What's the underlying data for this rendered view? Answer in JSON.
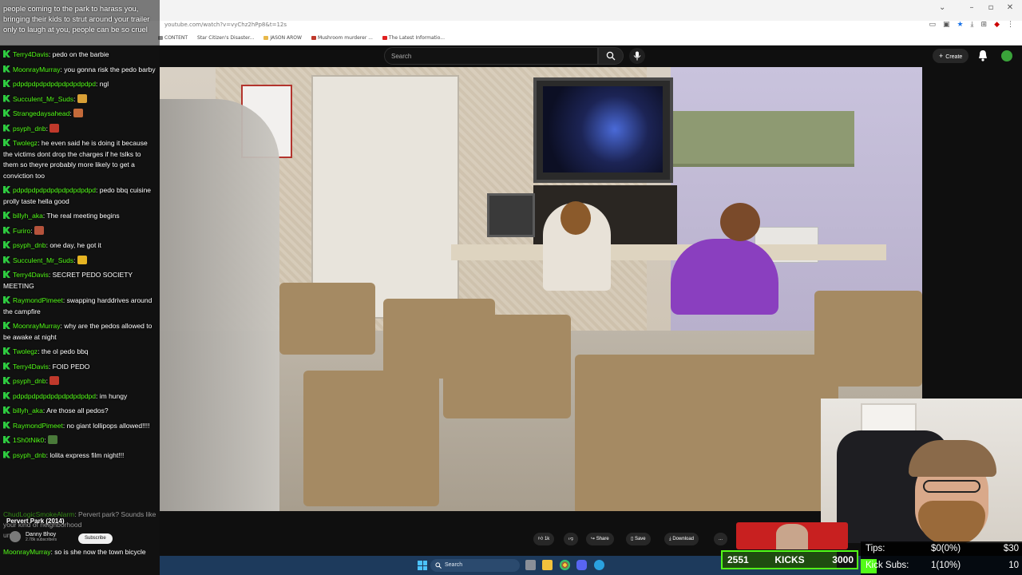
{
  "browser": {
    "url": "youtube.com/watch?v=vyChz2hPp8&t=12s",
    "bookmarks": [
      "CONTENT",
      "Star Citizen's Disaster...",
      "JASON AROW",
      "Mushroom murderer ...",
      "The Latest Informatio..."
    ]
  },
  "youtube": {
    "search_placeholder": "Search",
    "create_label": "Create",
    "likes": "1k",
    "share_label": "Share",
    "save_label": "Save",
    "download_label": "Download",
    "more_label": "...",
    "channel_name": "Danny Bhoy",
    "channel_subs": "2.78k subscribers",
    "subscribe_label": "Subscribe"
  },
  "chat": {
    "top_text": "people coming to the park to harass you, bringing their kids to strut around your trailer only to laugh at you, people can be so cruel",
    "messages": [
      {
        "user": "Terry4Davis",
        "text": "pedo on the barbie"
      },
      {
        "user": "MoonrayMurray",
        "text": "you gonna risk the pedo barby"
      },
      {
        "user": "pdpdpdpdpdpdpdpdpdpdpd",
        "text": "ngl"
      },
      {
        "user": "Succulent_Mr_Suds",
        "text": "",
        "emote": "#d9a036"
      },
      {
        "user": "Strangedaysahead",
        "text": "",
        "emote": "#c46a3a"
      },
      {
        "user": "psyph_dnb",
        "text": "",
        "emote": "#c0392b"
      },
      {
        "user": "Twolegz",
        "text": "he even said he is doing it because the victims dont drop the charges if he tslks to them so theyre probably more likely to get a conviction too"
      },
      {
        "user": "pdpdpdpdpdpdpdpdpdpdpd",
        "text": "pedo bbq cuisine prolly taste hella good"
      },
      {
        "user": "billyh_aka",
        "text": "The real meeting begins"
      },
      {
        "user": "Furiro",
        "text": "",
        "emote": "#b5533c"
      },
      {
        "user": "psyph_dnb",
        "text": "one day, he got it"
      },
      {
        "user": "Succulent_Mr_Suds",
        "text": "",
        "emote": "#e6b422"
      },
      {
        "user": "Terry4Davis",
        "text": "SECRET PEDO SOCIETY MEETING"
      },
      {
        "user": "RaymondPimeet",
        "text": "swapping harddrives around the campfire"
      },
      {
        "user": "MoonrayMurray",
        "text": "why are the pedos allowed to be awake at night"
      },
      {
        "user": "Twolegz",
        "text": "the ol pedo bbq"
      },
      {
        "user": "Terry4Davis",
        "text": "FOID PEDO"
      },
      {
        "user": "psyph_dnb",
        "text": "",
        "emote": "#c0392b"
      },
      {
        "user": "pdpdpdpdpdpdpdpdpdpdpd",
        "text": "im hungy"
      },
      {
        "user": "billyh_aka",
        "text": "Are those all pedos?"
      },
      {
        "user": "RaymondPimeet",
        "text": "no giant lollipops allowed!!!!"
      },
      {
        "user": "1Sh0tNik0",
        "text": "",
        "emote": "#4a7a3a"
      },
      {
        "user": "psyph_dnb",
        "text": "lolita express film night!!!"
      }
    ],
    "faded_user": "ChudLogicSmokeAlarm",
    "faded_text": "Pervert park? Sounds like your kind of neighborhood",
    "faded_tail": "unc",
    "video_title": "Pervert Park (2014)",
    "last_user": "MoonrayMurray",
    "last_text": "so is she now the town bicycle"
  },
  "taskbar": {
    "search_label": "Search"
  },
  "overlay": {
    "kicks_current": "2551",
    "kicks_label": "KICKS",
    "kicks_goal": "3000",
    "kicks_progress": 0.85,
    "tips_label": "Tips:",
    "tips_value": "$0(0%)",
    "tips_goal": "$30",
    "subs_label": "Kick Subs:",
    "subs_value": "1(10%)",
    "subs_goal": "10"
  },
  "colors": {
    "kick_green": "#53fc18",
    "yt_bg": "#0f0f0f",
    "taskbar": "#1d3a5c"
  }
}
